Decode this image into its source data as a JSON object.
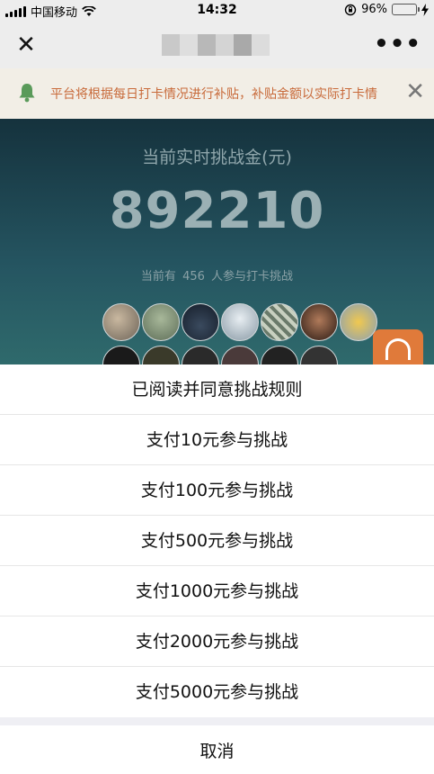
{
  "status_bar": {
    "carrier": "中国移动",
    "time": "14:32",
    "battery": "96%",
    "battery_level": 0.96
  },
  "nav": {
    "close_icon": "close-icon",
    "more_icon": "more-icon"
  },
  "notice": {
    "text": "平台将根据每日打卡情况进行补贴，补贴金额以实际打卡情",
    "bell_icon": "bell-icon",
    "close_icon": "close-icon"
  },
  "hero": {
    "label": "当前实时挑战金(元)",
    "amount": "892210",
    "count_prefix": "当前有",
    "count": "456",
    "count_suffix": "人参与打卡挑战"
  },
  "sheet": {
    "items": [
      "已阅读并同意挑战规则",
      "支付10元参与挑战",
      "支付100元参与挑战",
      "支付500元参与挑战",
      "支付1000元参与挑战",
      "支付2000元参与挑战",
      "支付5000元参与挑战"
    ],
    "cancel": "取消"
  },
  "colors": {
    "accent_orange": "#e07a3a",
    "notice_text": "#c86a3a",
    "battery_green": "#4cd964"
  }
}
